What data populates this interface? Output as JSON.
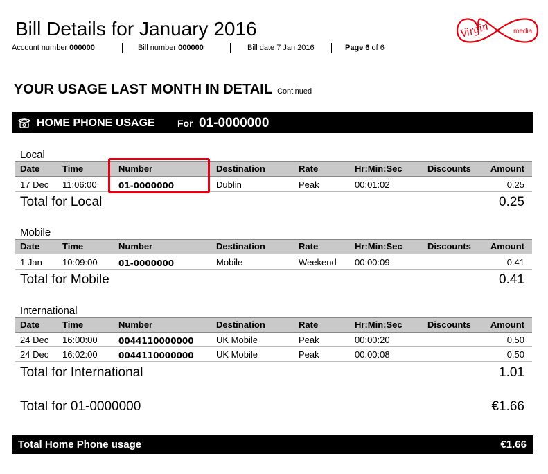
{
  "header": {
    "title": "Bill Details for January 2016",
    "account_label": "Account number",
    "account_value": "000000",
    "bill_label": "Bill number",
    "bill_value": "000000",
    "bill_date": "Bill date 7 Jan 2016",
    "page_label": "Page",
    "page_current": "6",
    "page_of": "of 6"
  },
  "logo": {
    "brand": "Virgin",
    "sub": "media",
    "color": "#e3000f"
  },
  "section": {
    "title": "YOUR USAGE LAST MONTH IN DETAIL",
    "sub": "Continued"
  },
  "phone_bar": {
    "label": "HOME PHONE USAGE",
    "for_label": "For",
    "number": "01-0000000",
    "icon": "telephone-icon"
  },
  "columns": [
    "Date",
    "Time",
    "Number",
    "Destination",
    "Rate",
    "Hr:Min:Sec",
    "Discounts",
    "Amount"
  ],
  "groups": [
    {
      "name": "Local",
      "rows": [
        {
          "date": "17 Dec",
          "time": "11:06:00",
          "number": "01-0000000",
          "destination": "Dublin",
          "rate": "Peak",
          "duration": "00:01:02",
          "discounts": "",
          "amount": "0.25"
        }
      ],
      "total_label": "Total for Local",
      "total_value": "0.25"
    },
    {
      "name": "Mobile",
      "rows": [
        {
          "date": "1 Jan",
          "time": "10:09:00",
          "number": "01-0000000",
          "destination": "Mobile",
          "rate": "Weekend",
          "duration": "00:00:09",
          "discounts": "",
          "amount": "0.41"
        }
      ],
      "total_label": "Total for Mobile",
      "total_value": "0.41"
    },
    {
      "name": "International",
      "rows": [
        {
          "date": "24 Dec",
          "time": "16:00:00",
          "number": "0044110000000",
          "destination": "UK Mobile",
          "rate": "Peak",
          "duration": "00:00:20",
          "discounts": "",
          "amount": "0.50"
        },
        {
          "date": "24 Dec",
          "time": "16:02:00",
          "number": "0044110000000",
          "destination": "UK Mobile",
          "rate": "Peak",
          "duration": "00:00:08",
          "discounts": "",
          "amount": "0.50"
        }
      ],
      "total_label": "Total for International",
      "total_value": "1.01"
    }
  ],
  "line_total": {
    "label": "Total for 01-0000000",
    "value": "€1.66"
  },
  "grand_total": {
    "label": "Total Home Phone usage",
    "value": "€1.66"
  },
  "highlight_color": "#e3000f"
}
